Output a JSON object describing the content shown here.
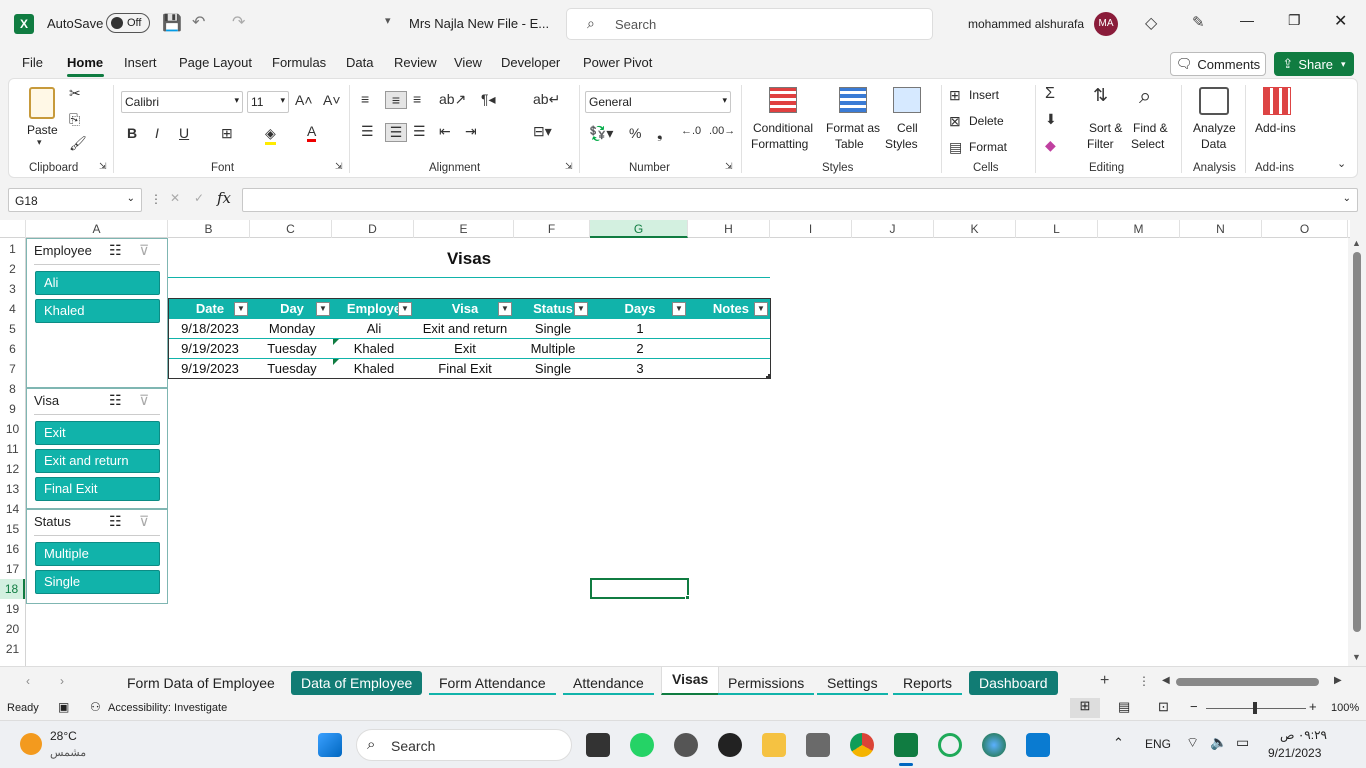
{
  "title_bar": {
    "autosave_label": "AutoSave",
    "autosave_state": "Off",
    "file_title": "Mrs Najla New File  -  E...",
    "search_placeholder": "Search",
    "user_name": "mohammed alshurafa",
    "user_initials": "MA"
  },
  "menu": [
    "File",
    "Home",
    "Insert",
    "Page Layout",
    "Formulas",
    "Data",
    "Review",
    "View",
    "Developer",
    "Power Pivot"
  ],
  "menu_active": "Home",
  "comments_label": "Comments",
  "share_label": "Share",
  "ribbon": {
    "clipboard": {
      "paste": "Paste",
      "label": "Clipboard"
    },
    "font": {
      "name": "Calibri",
      "size": "11",
      "label": "Font",
      "bold": "B",
      "italic": "I",
      "underline": "U"
    },
    "alignment": {
      "label": "Alignment"
    },
    "number": {
      "format": "General",
      "label": "Number"
    },
    "styles": {
      "conditional": "Conditional",
      "conditional2": "Formatting",
      "format_as": "Format as",
      "format_as2": "Table",
      "cell": "Cell",
      "cell2": "Styles",
      "label": "Styles"
    },
    "cells": {
      "insert": "Insert",
      "delete": "Delete",
      "format": "Format",
      "label": "Cells"
    },
    "editing": {
      "sort": "Sort &",
      "sort2": "Filter",
      "find": "Find &",
      "find2": "Select",
      "label": "Editing"
    },
    "analysis": {
      "analyze": "Analyze",
      "analyze2": "Data",
      "label": "Analysis"
    },
    "addins": {
      "addins": "Add-ins",
      "label": "Add-ins"
    }
  },
  "name_box": "G18",
  "formula": "",
  "columns": [
    "A",
    "B",
    "C",
    "D",
    "E",
    "F",
    "G",
    "H",
    "I",
    "J",
    "K",
    "L",
    "M",
    "N",
    "O"
  ],
  "rows": [
    "1",
    "2",
    "3",
    "4",
    "5",
    "6",
    "7",
    "8",
    "9",
    "10",
    "11",
    "12",
    "13",
    "14",
    "15",
    "16",
    "17",
    "18",
    "19",
    "20",
    "21"
  ],
  "sheet": {
    "title": "Visas",
    "headers": [
      "Date",
      "Day",
      "Employe",
      "Visa",
      "Status",
      "Days",
      "Notes"
    ],
    "data": [
      [
        "9/18/2023",
        "Monday",
        "Ali",
        "Exit and return",
        "Single",
        "1",
        ""
      ],
      [
        "9/19/2023",
        "Tuesday",
        "Khaled",
        "Exit",
        "Multiple",
        "2",
        ""
      ],
      [
        "9/19/2023",
        "Tuesday",
        "Khaled",
        "Final Exit",
        "Single",
        "3",
        ""
      ]
    ]
  },
  "slicers": {
    "employee": {
      "title": "Employee",
      "items": [
        "Ali",
        "Khaled"
      ]
    },
    "visa": {
      "title": "Visa",
      "items": [
        "Exit",
        "Exit and return",
        "Final Exit"
      ]
    },
    "status": {
      "title": "Status",
      "items": [
        "Multiple",
        "Single"
      ]
    }
  },
  "tabs": [
    "Form Data of Employee",
    "Data of Employee",
    "Form Attendance",
    "Attendance",
    "Visas",
    "Permissions",
    "Settings",
    "Reports",
    "Dashboard"
  ],
  "active_tab": "Visas",
  "status": {
    "ready": "Ready",
    "accessibility": "Accessibility: Investigate",
    "zoom": "100%"
  },
  "taskbar": {
    "temp": "28°C",
    "weather": "مشمس",
    "search": "Search",
    "lang": "ENG",
    "time": "٠٩:٢٩ ص",
    "date": "9/21/2023"
  },
  "colors": {
    "accent": "#107c41",
    "slicer": "#11b3aa",
    "table_header": "#11b3aa",
    "tab_green": "#117c74"
  }
}
